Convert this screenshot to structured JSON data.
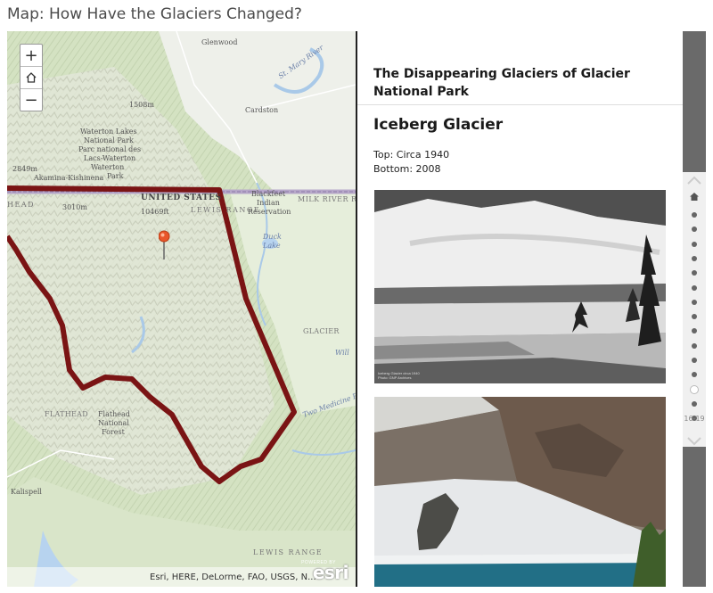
{
  "page": {
    "title": "Map: How Have the Glaciers Changed?"
  },
  "map": {
    "zoom_in": "+",
    "zoom_out": "−",
    "attribution": "Esri, HERE, DeLorme, FAO, USGS, N...",
    "logo_text": "esri",
    "logo_powered": "POWERED BY",
    "labels": {
      "glenwood": "Glenwood",
      "st_mary_river": "St. Mary River",
      "elev_1508": "1508m",
      "cardston": "Cardston",
      "waterton_1": "Waterton Lakes",
      "waterton_2": "National Park",
      "waterton_3": "Parc national des",
      "waterton_4": "Lacs-Waterton",
      "waterton_town": "Waterton",
      "park": "Park",
      "elev_2849": "2849m",
      "akamina": "Akamina-Kishinena",
      "united_states": "UNITED STATES",
      "elev_3010": "3010m",
      "elev_10469": "10469ft",
      "lewis_range_top": "LEWIS RANGE",
      "blackfeet_1": "Blackfeet",
      "blackfeet_2": "Indian",
      "blackfeet_3": "Reservation",
      "milk_river": "MILK RIVER R",
      "head": "HEAD",
      "duck_lake_1": "Duck",
      "duck_lake_2": "Lake",
      "glacier": "GLACIER",
      "will": "Will",
      "two_medicine": "Two Medicine R",
      "flathead": "FLATHEAD",
      "flathead_nf_1": "Flathead",
      "flathead_nf_2": "National",
      "flathead_nf_3": "Forest",
      "kalispell": "Kalispell",
      "lewis_range_bottom": "LEWIS RANGE"
    }
  },
  "panel": {
    "title": "The Disappearing Glaciers of Glacier National Park",
    "section_title": "Iceberg Glacier",
    "caption_top": "Top: Circa 1940",
    "caption_bottom": "Bottom: 2008",
    "photo1_caption_1": "Iceberg Glacier circa 1940",
    "photo1_caption_2": "Photo: GNP Archives"
  },
  "nav": {
    "range": "16-19",
    "active_index": 12,
    "dot_count": 15
  },
  "colors": {
    "boundary": "#7a1414",
    "rail": "#6a6a6a",
    "pin": "#e8562a"
  }
}
